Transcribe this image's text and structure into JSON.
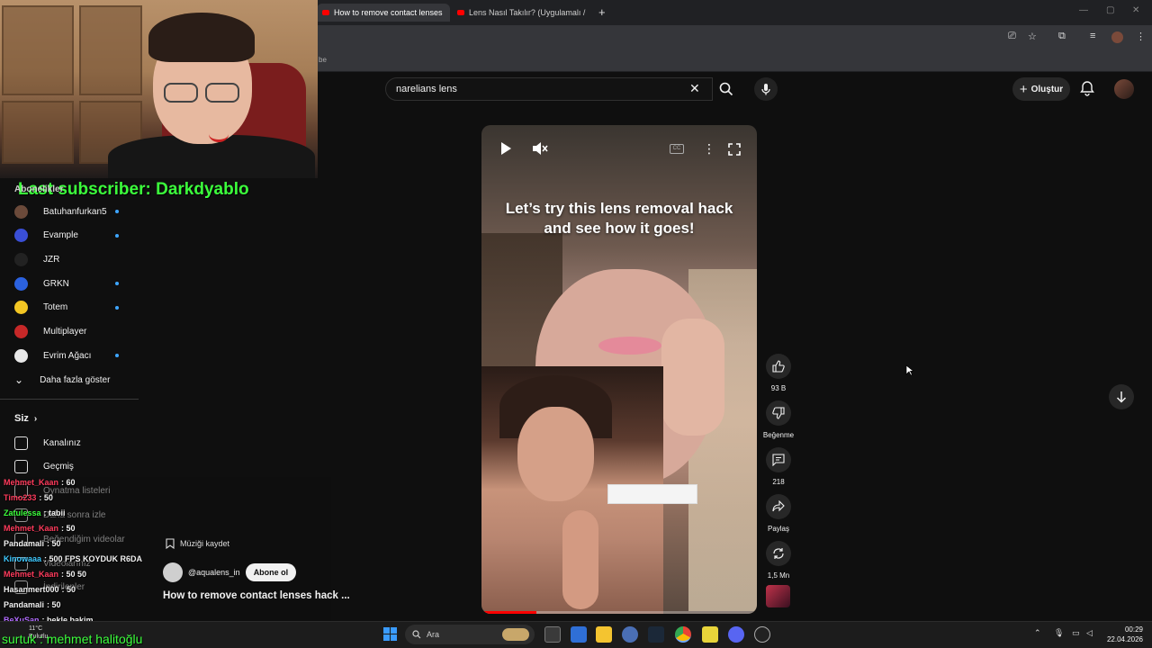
{
  "browser": {
    "tabs": [
      {
        "label": "How to remove contact lenses",
        "active": true
      },
      {
        "label": "Lens Nasıl Takılır? (Uygulamalı /",
        "active": false
      }
    ],
    "new_tab": "+",
    "bookmark_fragment": "be"
  },
  "header": {
    "search_value": "narelians lens",
    "create_label": "Oluştur"
  },
  "overlay": {
    "last_subscriber": "Last subscriber: Darkdyablo",
    "stream_name": "surtuk : mehmet halitoğlu"
  },
  "sidebar": {
    "subscriptions_title": "Abonelikler",
    "subscriptions": [
      {
        "name": "Batuhanfurkan5",
        "color": "#6b4a3a",
        "live": true
      },
      {
        "name": "Evample",
        "color": "#3a4fd6",
        "live": true
      },
      {
        "name": "JZR",
        "color": "#222222",
        "live": false
      },
      {
        "name": "GRKN",
        "color": "#2b62e0",
        "live": true
      },
      {
        "name": "Totem",
        "color": "#f3c623",
        "live": true
      },
      {
        "name": "Multiplayer",
        "color": "#c62828",
        "live": false
      },
      {
        "name": "Evrim Ağacı",
        "color": "#e8e8e8",
        "live": true
      }
    ],
    "show_more": "Daha fazla göster",
    "you_title": "Siz",
    "you_items": [
      {
        "label": "Kanalınız",
        "icon": "channel-icon"
      },
      {
        "label": "Geçmiş",
        "icon": "history-icon"
      },
      {
        "label": "Oynatma listeleri",
        "icon": "playlist-icon"
      },
      {
        "label": "Daha sonra izle",
        "icon": "watch-later-icon"
      },
      {
        "label": "Beğendiğim videolar",
        "icon": "like-icon"
      },
      {
        "label": "Videolarınız",
        "icon": "video-icon"
      },
      {
        "label": "İndirilenler",
        "icon": "download-icon"
      }
    ]
  },
  "chat": [
    {
      "user": "Mehmet_Kaan",
      "msg": ": 60",
      "color": "#ff3b5c"
    },
    {
      "user": "Timo233",
      "msg": ": 50",
      "color": "#ff3b5c"
    },
    {
      "user": "Zatulessa",
      "msg": ": tabii",
      "color": "#3cff3c"
    },
    {
      "user": "Mehmet_Kaan",
      "msg": ": 50",
      "color": "#ff3b5c"
    },
    {
      "user": "Pandamali",
      "msg": ": 50",
      "color": "#f1f1f1"
    },
    {
      "user": "Kinowaaa",
      "msg": ": 500 FPS KOYDUK R6DA",
      "color": "#3ec9ff"
    },
    {
      "user": "Mehmet_Kaan",
      "msg": ": 50 50",
      "color": "#ff3b5c"
    },
    {
      "user": "Hasanmert000",
      "msg": ": 50",
      "color": "#f1f1f1"
    },
    {
      "user": "Pandamali",
      "msg": ": 50",
      "color": "#f1f1f1"
    },
    {
      "user": "BeXuSan",
      "msg": ": bekle bakim",
      "color": "#b26bff"
    }
  ],
  "short": {
    "caption": "Let’s try this lens removal hack and see how it goes!",
    "save_music": "Müziği kaydet",
    "channel": "@aqualens_in",
    "subscribe": "Abone ol",
    "title": "How to remove contact lenses hack ...",
    "progress": 0.2,
    "likes": "93 B",
    "dislike_label": "Beğenme",
    "comments": "218",
    "share_label": "Paylaş",
    "remix_count": "1,5 Mn"
  },
  "taskbar": {
    "search_placeholder": "Ara",
    "weather_temp": "11°C",
    "weather_desc": "Bulutlu",
    "time": "00:29",
    "date": "22.04.2026"
  }
}
